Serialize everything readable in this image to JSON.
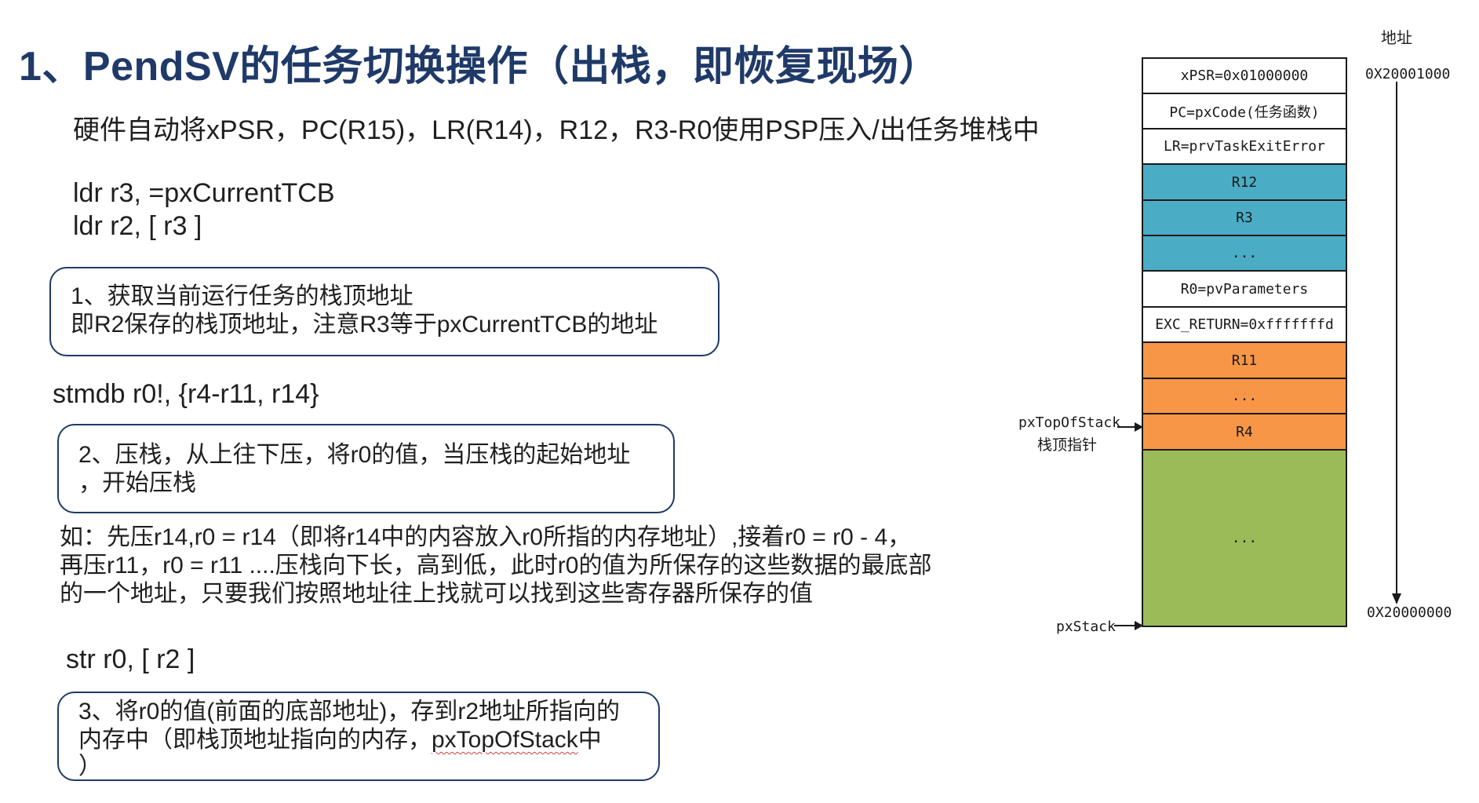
{
  "title": "1、PendSV的任务切换操作（出栈，即恢复现场）",
  "intro": "硬件自动将xPSR，PC(R15)，LR(R14)，R12，R3-R0使用PSP压入/出任务堆栈中",
  "code1_line1": "ldr r3, =pxCurrentTCB",
  "code1_line2": "ldr r2, [ r3 ]",
  "box1": {
    "line1": "1、获取当前运行任务的栈顶地址",
    "line2": "即R2保存的栈顶地址，注意R3等于pxCurrentTCB的地址"
  },
  "code2": "stmdb r0!, {r4-r11, r14}",
  "box2": {
    "line1": "2、压栈，从上往下压，将r0的值，当压栈的起始地址",
    "line2": "，开始压栈"
  },
  "example": {
    "line1": "如：先压r14,r0 = r14（即将r14中的内容放入r0所指的内存地址）,接着r0 = r0 - 4，",
    "line2": "再压r11，r0 = r11 ....压栈向下长，高到低，此时r0的值为所保存的这些数据的最底部",
    "line3": "的一个地址，只要我们按照地址往上找就可以找到这些寄存器所保存的值"
  },
  "code3": "str r0, [ r2 ]",
  "box3": {
    "line1": "3、将r0的值(前面的底部地址)，存到r2地址所指向的",
    "line2_prefix": "内存中（即栈顶地址指向的内存，",
    "line2_underlined": "pxTopOfStack",
    "line2_suffix": "中",
    "line3": "）"
  },
  "diagram": {
    "addr_header": "地址",
    "addr_high": "0X20001000",
    "addr_low": "0X20000000",
    "top_pointer_label": "pxTopOfStack",
    "top_pointer_sublabel": "栈顶指针",
    "stack_label": "pxStack",
    "cells": [
      {
        "label": "xPSR=0x01000000",
        "color": "#ffffff"
      },
      {
        "label": "PC=pxCode(任务函数)",
        "color": "#ffffff"
      },
      {
        "label": "LR=prvTaskExitError",
        "color": "#ffffff"
      },
      {
        "label": "R12",
        "color": "#4bacc6"
      },
      {
        "label": "R3",
        "color": "#4bacc6"
      },
      {
        "label": "...",
        "color": "#4bacc6"
      },
      {
        "label": "R0=pvParameters",
        "color": "#ffffff"
      },
      {
        "label": "EXC_RETURN=0xfffffffd",
        "color": "#ffffff"
      },
      {
        "label": "R11",
        "color": "#f79646"
      },
      {
        "label": "...",
        "color": "#f79646"
      },
      {
        "label": "R4",
        "color": "#f79646"
      },
      {
        "label": "...",
        "color": "#9bbb59"
      }
    ]
  }
}
